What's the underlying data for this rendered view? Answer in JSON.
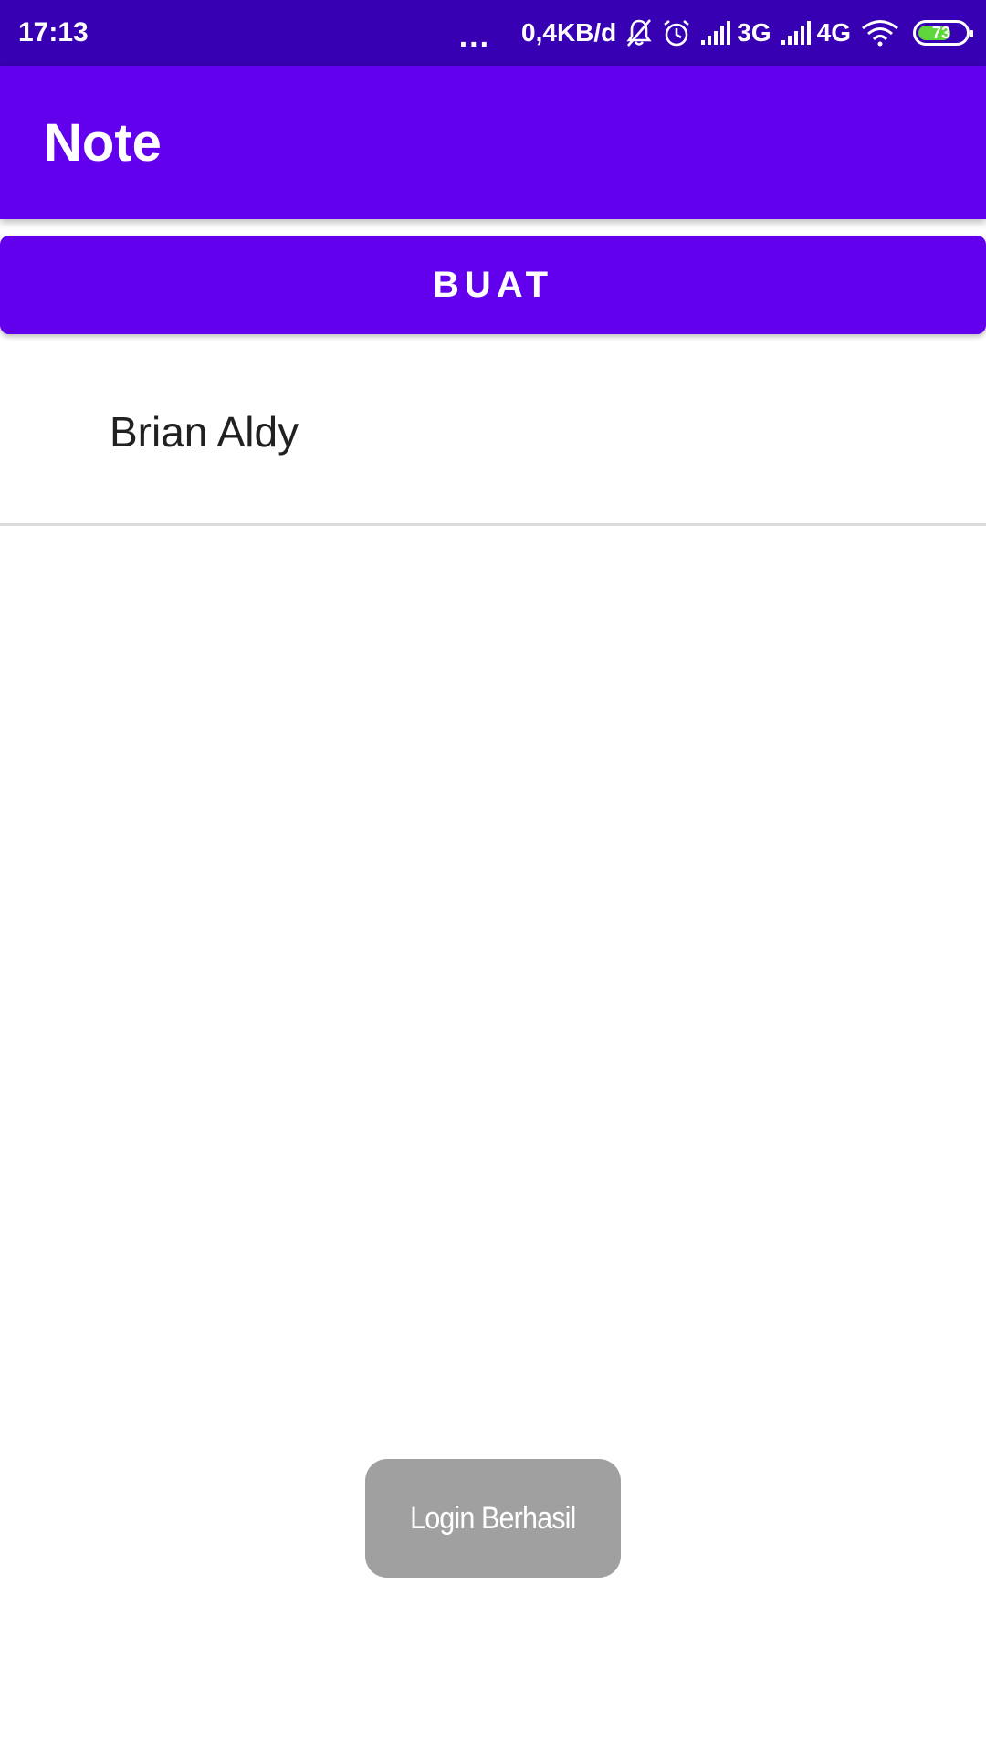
{
  "status_bar": {
    "time": "17:13",
    "more": "...",
    "speed": "0,4KB/d",
    "network_1": "3G",
    "network_2": "4G",
    "battery_level": "73",
    "battery_fraction": 0.73,
    "icons": [
      "mute-bell-icon",
      "alarm-icon",
      "signal-icon",
      "signal-icon",
      "wifi-icon",
      "battery-icon"
    ]
  },
  "app_bar": {
    "title": "Note"
  },
  "create_button": {
    "label": "BUAT"
  },
  "notes": [
    {
      "title": "Brian Aldy"
    }
  ],
  "toast": {
    "message": "Login Berhasil"
  },
  "colors": {
    "status_bar": "#3700b3",
    "primary": "#6200ee",
    "toast_bg": "#a0a0a0",
    "battery_fill": "#5fd63a",
    "text_primary": "#212121",
    "divider": "#dcdcdc"
  }
}
